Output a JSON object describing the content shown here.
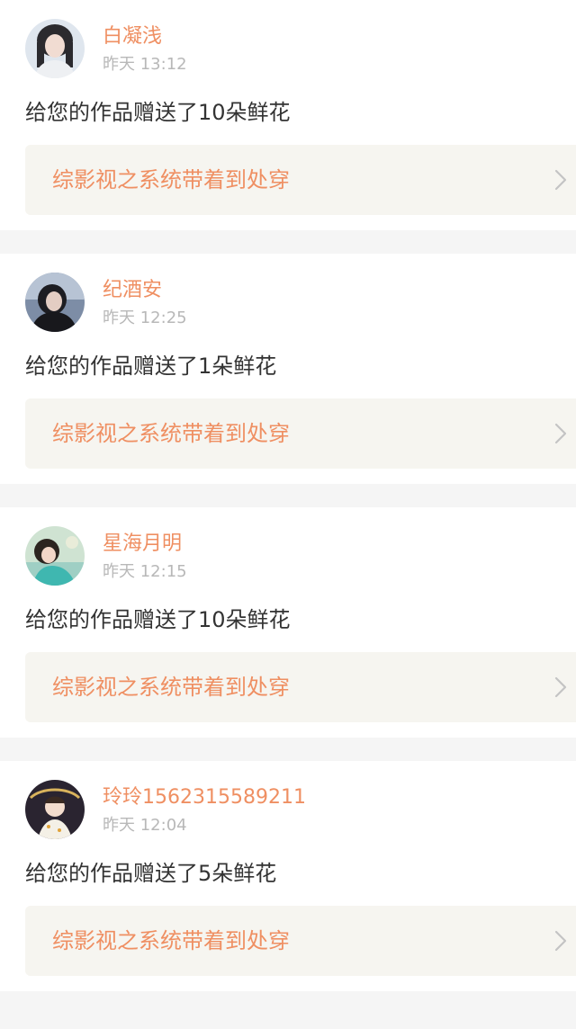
{
  "colors": {
    "name": "#ef8f62",
    "time": "#b8b8b8",
    "message": "#333333",
    "link_bg": "#f6f5f0",
    "page_bg": "#f5f5f5"
  },
  "notifications": [
    {
      "user": "白凝浅",
      "time": "昨天 13:12",
      "message": "给您的作品赠送了10朵鲜花",
      "work_title": "综影视之系统带着到处穿",
      "avatar_icon": "user-avatar-icon"
    },
    {
      "user": "纪酒安",
      "time": "昨天 12:25",
      "message": "给您的作品赠送了1朵鲜花",
      "work_title": "综影视之系统带着到处穿",
      "avatar_icon": "user-avatar-icon"
    },
    {
      "user": "星海月明",
      "time": "昨天 12:15",
      "message": "给您的作品赠送了10朵鲜花",
      "work_title": "综影视之系统带着到处穿",
      "avatar_icon": "user-avatar-icon"
    },
    {
      "user": "玲玲1562315589211",
      "time": "昨天 12:04",
      "message": "给您的作品赠送了5朵鲜花",
      "work_title": "综影视之系统带着到处穿",
      "avatar_icon": "user-avatar-icon"
    }
  ]
}
